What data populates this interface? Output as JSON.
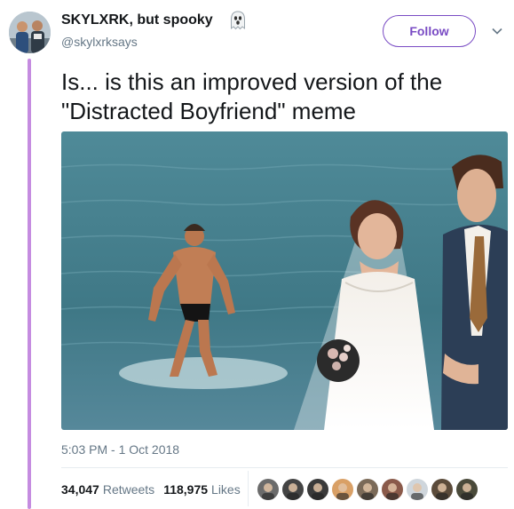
{
  "author": {
    "display_name": "SKYLXRK, but spooky",
    "handle": "@skylxrksays",
    "name_emoji": "ghost-icon"
  },
  "header": {
    "follow_label": "Follow",
    "menu_icon": "chevron-down-icon"
  },
  "tweet": {
    "text": "Is... is this an improved version of the \"Distracted Boyfriend\" meme",
    "timestamp": "5:03 PM - 1 Oct 2018"
  },
  "stats": {
    "retweets_count": "34,047",
    "retweets_label": "Retweets",
    "likes_count": "118,975",
    "likes_label": "Likes"
  },
  "colors": {
    "accent": "#794bc4",
    "thread_line": "#c58ce0",
    "text": "#14171a",
    "secondary_text": "#657786"
  },
  "liker_avatars": [
    "#6b6b6b",
    "#444444",
    "#3a3a3a",
    "#d9a066",
    "#7b6a58",
    "#8a5a4a",
    "#cfd6dc",
    "#5b4b3a",
    "#4a4a3a"
  ]
}
